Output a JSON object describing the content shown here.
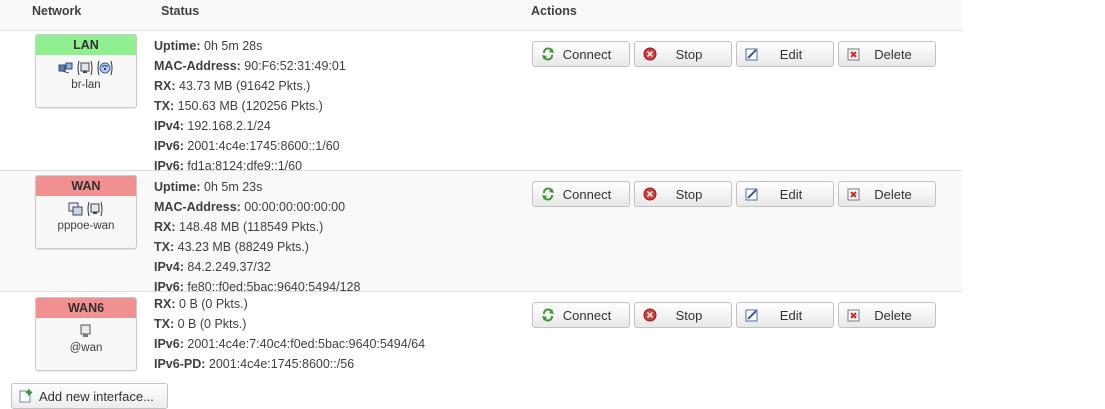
{
  "headers": {
    "network": "Network",
    "status": "Status",
    "actions": "Actions"
  },
  "interfaces": [
    {
      "name": "LAN",
      "device": "br-lan",
      "color": "#90f090",
      "icons": [
        "bridge-icon",
        "ethernet-port-icon",
        "wifi-icon"
      ],
      "status": [
        {
          "key": "Uptime:",
          "value": "0h 5m 28s"
        },
        {
          "key": "MAC-Address:",
          "value": "90:F6:52:31:49:01"
        },
        {
          "key": "RX:",
          "value": "43.73 MB (91642 Pkts.)"
        },
        {
          "key": "TX:",
          "value": "150.63 MB (120256 Pkts.)"
        },
        {
          "key": "IPv4:",
          "value": "192.168.2.1/24"
        },
        {
          "key": "IPv6:",
          "value": "2001:4c4e:1745:8600::1/60"
        },
        {
          "key": "IPv6:",
          "value": "fd1a:8124:dfe9::1/60"
        }
      ]
    },
    {
      "name": "WAN",
      "device": "pppoe-wan",
      "color": "#f09090",
      "icons": [
        "tunnel-icon",
        "ethernet-port-icon"
      ],
      "status": [
        {
          "key": "Uptime:",
          "value": "0h 5m 23s"
        },
        {
          "key": "MAC-Address:",
          "value": "00:00:00:00:00:00"
        },
        {
          "key": "RX:",
          "value": "148.48 MB (118549 Pkts.)"
        },
        {
          "key": "TX:",
          "value": "43.23 MB (88249 Pkts.)"
        },
        {
          "key": "IPv4:",
          "value": "84.2.249.37/32"
        },
        {
          "key": "IPv6:",
          "value": "fe80::f0ed:5bac:9640:5494/128"
        }
      ]
    },
    {
      "name": "WAN6",
      "device": "@wan",
      "color": "#f09090",
      "icons": [
        "alias-icon"
      ],
      "status": [
        {
          "key": "RX:",
          "value": "0 B (0 Pkts.)"
        },
        {
          "key": "TX:",
          "value": "0 B (0 Pkts.)"
        },
        {
          "key": "IPv6:",
          "value": "2001:4c4e:7:40c4:f0ed:5bac:9640:5494/64"
        },
        {
          "key": "IPv6-PD:",
          "value": "2001:4c4e:1745:8600::/56"
        }
      ]
    }
  ],
  "actions": {
    "connect": "Connect",
    "stop": "Stop",
    "edit": "Edit",
    "delete": "Delete"
  },
  "add_interface_label": "Add new interface..."
}
